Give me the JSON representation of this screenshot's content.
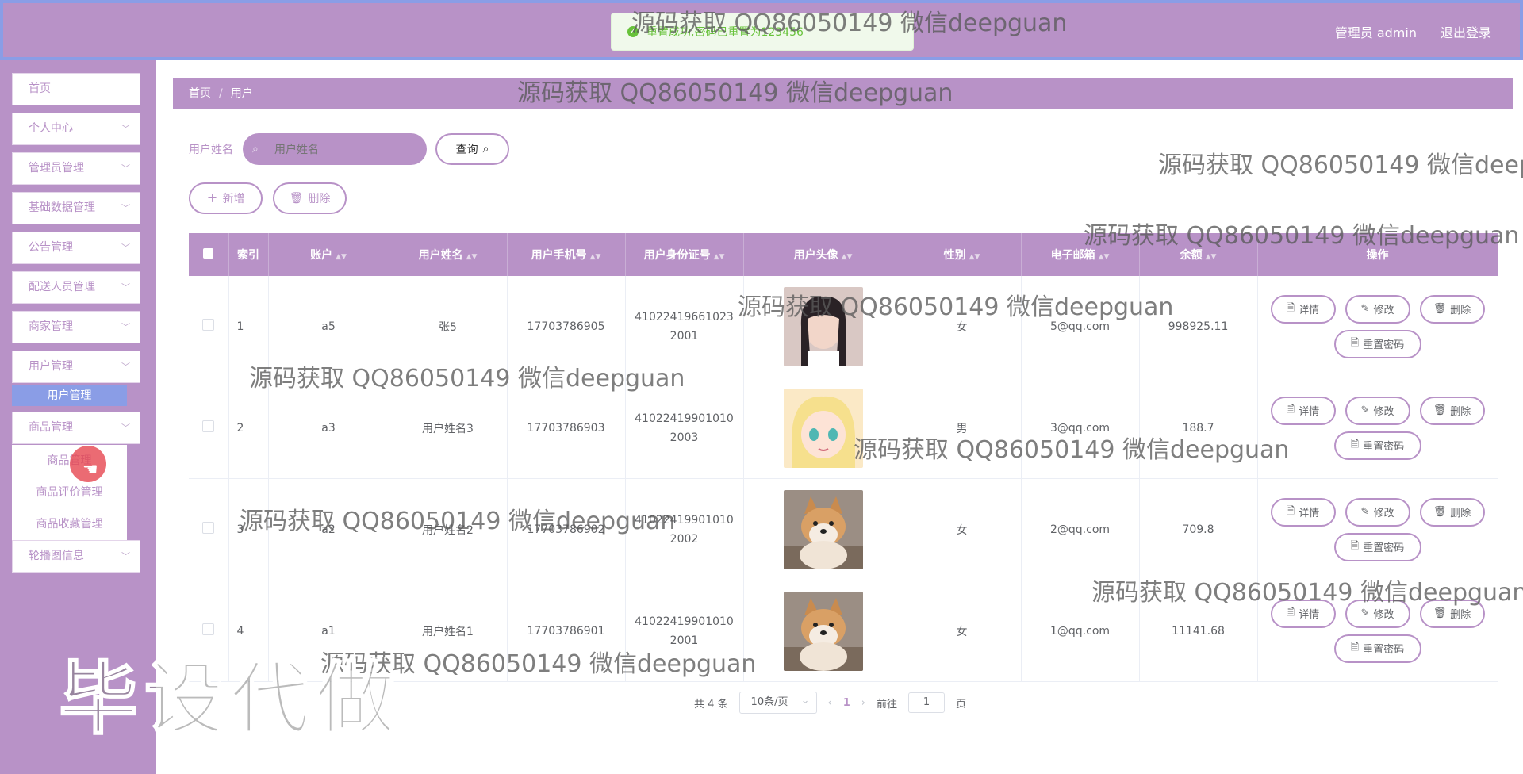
{
  "header": {
    "admin_label": "管理员 admin",
    "logout": "退出登录",
    "toast": "重置成功,密码已重置为123456"
  },
  "sidebar": {
    "items": [
      {
        "label": "首页"
      },
      {
        "label": "个人中心"
      },
      {
        "label": "管理员管理"
      },
      {
        "label": "基础数据管理"
      },
      {
        "label": "公告管理"
      },
      {
        "label": "配送人员管理"
      },
      {
        "label": "商家管理"
      },
      {
        "label": "用户管理"
      },
      {
        "label": "商品管理"
      },
      {
        "label": "轮播图信息"
      }
    ],
    "user_sub": [
      "用户管理"
    ],
    "goods_sub": [
      "商品管理",
      "商品评价管理",
      "商品收藏管理"
    ]
  },
  "breadcrumb": {
    "home": "首页",
    "current": "用户"
  },
  "search": {
    "label": "用户姓名",
    "placeholder": "用户姓名",
    "query": "查询"
  },
  "actions": {
    "add": "新增",
    "delete": "删除"
  },
  "table": {
    "headers": [
      "索引",
      "账户",
      "用户姓名",
      "用户手机号",
      "用户身份证号",
      "用户头像",
      "性别",
      "电子邮箱",
      "余额",
      "操作"
    ],
    "rows": [
      {
        "index": "1",
        "account": "a5",
        "name": "张5",
        "phone": "17703786905",
        "id_card": "410224196610232001",
        "avatar": "girl-photo",
        "gender": "女",
        "email": "5@qq.com",
        "balance": "998925.11"
      },
      {
        "index": "2",
        "account": "a3",
        "name": "用户姓名3",
        "phone": "17703786903",
        "id_card": "410224199010102003",
        "avatar": "anime-girl",
        "gender": "男",
        "email": "3@qq.com",
        "balance": "188.7"
      },
      {
        "index": "3",
        "account": "a2",
        "name": "用户姓名2",
        "phone": "17703786902",
        "id_card": "410224199010102002",
        "avatar": "shiba-dog",
        "gender": "女",
        "email": "2@qq.com",
        "balance": "709.8"
      },
      {
        "index": "4",
        "account": "a1",
        "name": "用户姓名1",
        "phone": "17703786901",
        "id_card": "410224199010102001",
        "avatar": "shiba-dog",
        "gender": "女",
        "email": "1@qq.com",
        "balance": "11141.68"
      }
    ],
    "op_labels": {
      "detail": "详情",
      "edit": "修改",
      "delete": "删除",
      "reset": "重置密码"
    }
  },
  "pagination": {
    "total": "共 4 条",
    "size": "10条/页",
    "page": "1",
    "goto_label": "前往",
    "goto_value": "1",
    "goto_suffix": "页"
  },
  "watermark": {
    "text": "源码获取 QQ86050149 微信deepguan",
    "text_cut": "源码获取 QQ86050149 微信deep",
    "big": "毕设代做"
  },
  "colors": {
    "primary": "#b892c7",
    "accent": "#8a9de6"
  }
}
